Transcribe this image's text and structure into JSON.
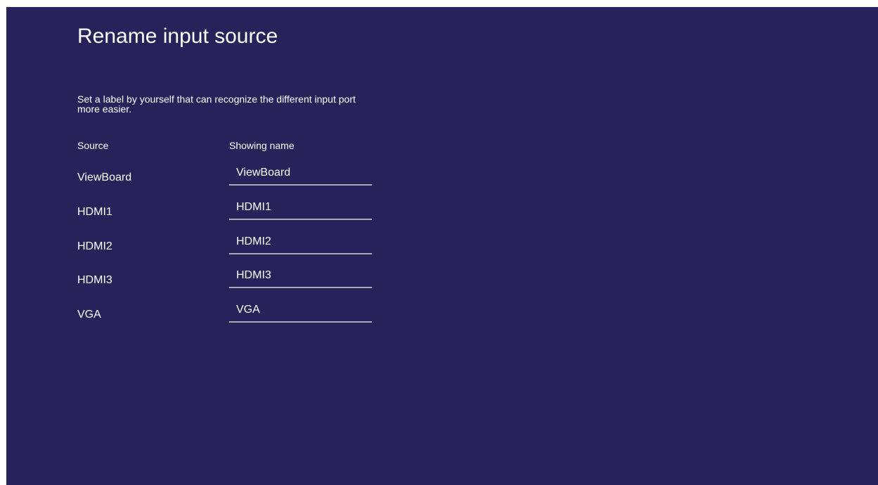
{
  "page": {
    "title": "Rename input source",
    "description": "Set a label by yourself that can recognize the different input port more easier."
  },
  "table": {
    "headers": {
      "source": "Source",
      "showing_name": "Showing name"
    },
    "rows": [
      {
        "source": "ViewBoard",
        "showing_name": "ViewBoard"
      },
      {
        "source": "HDMI1",
        "showing_name": "HDMI1"
      },
      {
        "source": "HDMI2",
        "showing_name": "HDMI2"
      },
      {
        "source": "HDMI3",
        "showing_name": "HDMI3"
      },
      {
        "source": "VGA",
        "showing_name": "VGA"
      }
    ]
  },
  "colors": {
    "background": "#25235a",
    "text": "#ffffff",
    "underline": "#a9a9b8"
  }
}
